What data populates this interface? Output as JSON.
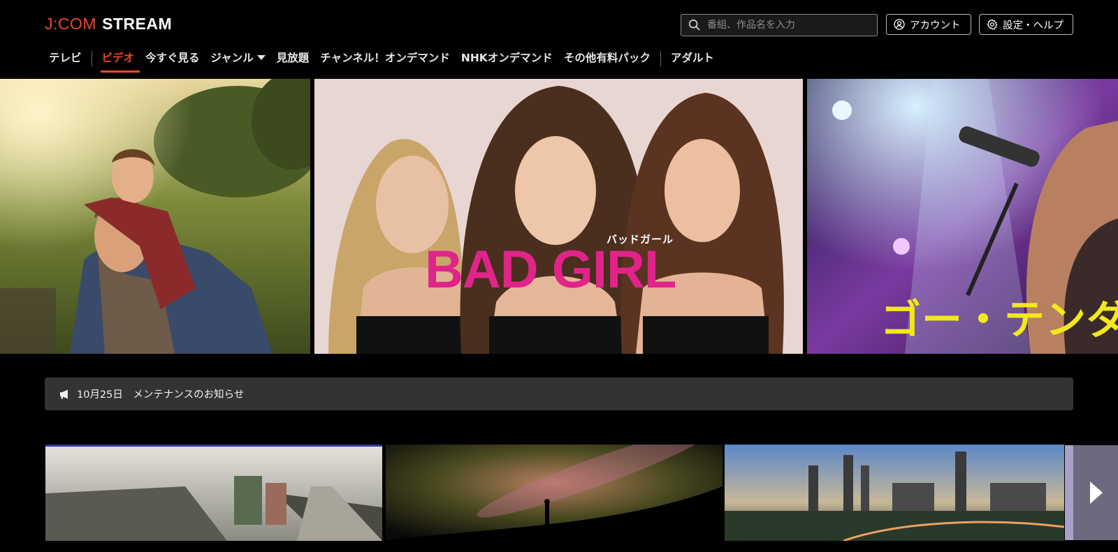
{
  "header": {
    "logo_brand": "J:COM",
    "logo_product": "STREAM",
    "search_placeholder": "番組、作品名を入力",
    "account_label": "アカウント",
    "settings_label": "設定・ヘルプ"
  },
  "nav": {
    "items": [
      {
        "label": "テレビ"
      },
      {
        "label": "ビデオ",
        "active": true
      },
      {
        "label": "今すぐ見る"
      },
      {
        "label": "ジャンル"
      },
      {
        "label": "見放題"
      },
      {
        "label": "チャンネル！オンデマンド"
      },
      {
        "label": "NHKオンデマンド"
      },
      {
        "label": "その他有料パック"
      },
      {
        "label": "アダルト"
      }
    ]
  },
  "hero": {
    "slides": [
      {
        "subject": "family outdoors"
      },
      {
        "title": "BAD GIRL",
        "subtitle": "バッドガール"
      },
      {
        "title": "ゴー・テンダ"
      }
    ]
  },
  "notice": {
    "text": "10月25日　メンテナンスのお知らせ",
    "icon": "megaphone-icon"
  },
  "colors": {
    "accent": "#e8472b",
    "bad_girl_pink": "#e0248a",
    "go_tenda_yellow": "#f3e81a",
    "notice_bg": "#333333"
  }
}
